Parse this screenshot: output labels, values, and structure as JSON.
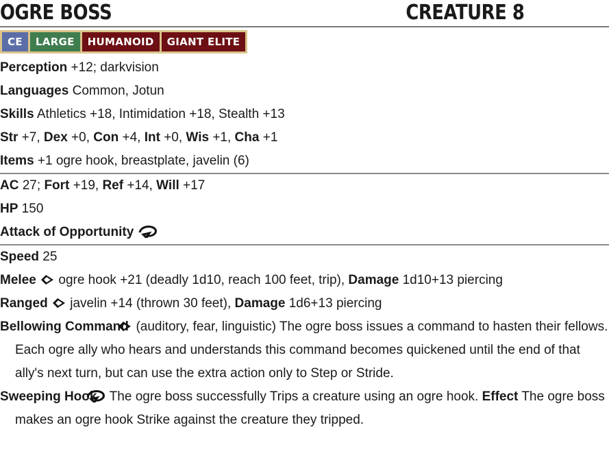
{
  "header": {
    "name": "OGRE BOSS",
    "level": "CREATURE 8"
  },
  "traits": [
    {
      "label": "CE",
      "color": "#5b6ea8"
    },
    {
      "label": "LARGE",
      "color": "#3f7d4f"
    },
    {
      "label": "HUMANOID",
      "color": "#6d0f14"
    },
    {
      "label": "GIANT ELITE",
      "color": "#6d0f14"
    }
  ],
  "perception": {
    "label": "Perception",
    "text": " +12; darkvision"
  },
  "languages": {
    "label": "Languages",
    "text": " Common, Jotun"
  },
  "skills": {
    "label": "Skills",
    "text": " Athletics +18, Intimidation +18, Stealth +13"
  },
  "abilities": [
    {
      "label": "Str",
      "value": " +7, "
    },
    {
      "label": "Dex",
      "value": " +0, "
    },
    {
      "label": "Con",
      "value": " +4, "
    },
    {
      "label": "Int",
      "value": " +0, "
    },
    {
      "label": "Wis",
      "value": " +1, "
    },
    {
      "label": "Cha",
      "value": " +1"
    }
  ],
  "items": {
    "label": "Items",
    "text": " +1 ogre hook, breastplate, javelin (6)"
  },
  "defense": {
    "ac_label": "AC",
    "ac_text": " 27; ",
    "fort_label": "Fort",
    "fort_text": " +19, ",
    "ref_label": "Ref",
    "ref_text": " +14, ",
    "will_label": "Will",
    "will_text": " +17"
  },
  "hp": {
    "label": "HP",
    "text": " 150"
  },
  "reaction": {
    "label": "Attack of Opportunity",
    "icon": "reaction-icon"
  },
  "speed": {
    "label": "Speed",
    "text": " 25"
  },
  "melee": {
    "label": "Melee",
    "icon": "single-action-icon",
    "text": " ogre hook +21 (deadly 1d10, reach 100 feet, trip), ",
    "damage_label": "Damage",
    "damage_text": " 1d10+13 piercing"
  },
  "ranged": {
    "label": "Ranged",
    "icon": "single-action-icon",
    "text": " javelin +14 (thrown 30 feet), ",
    "damage_label": "Damage",
    "damage_text": " 1d6+13 piercing"
  },
  "bellowing": {
    "label": "Bellowing Command",
    "icon": "single-action-icon",
    "text": " (auditory, fear, linguistic) The ogre boss issues a command to hasten their fellows. Each ogre ally who hears and understands this command becomes quickened until the end of that ally's next turn, but can use the extra action only to Step or Stride."
  },
  "sweeping": {
    "label": "Sweeping Hook",
    "icon": "reaction-icon",
    "text": " The ogre boss successfully Trips a creature using an ogre hook. ",
    "effect_label": "Effect",
    "effect_text": " The ogre boss makes an ogre hook Strike against the creature they tripped."
  }
}
